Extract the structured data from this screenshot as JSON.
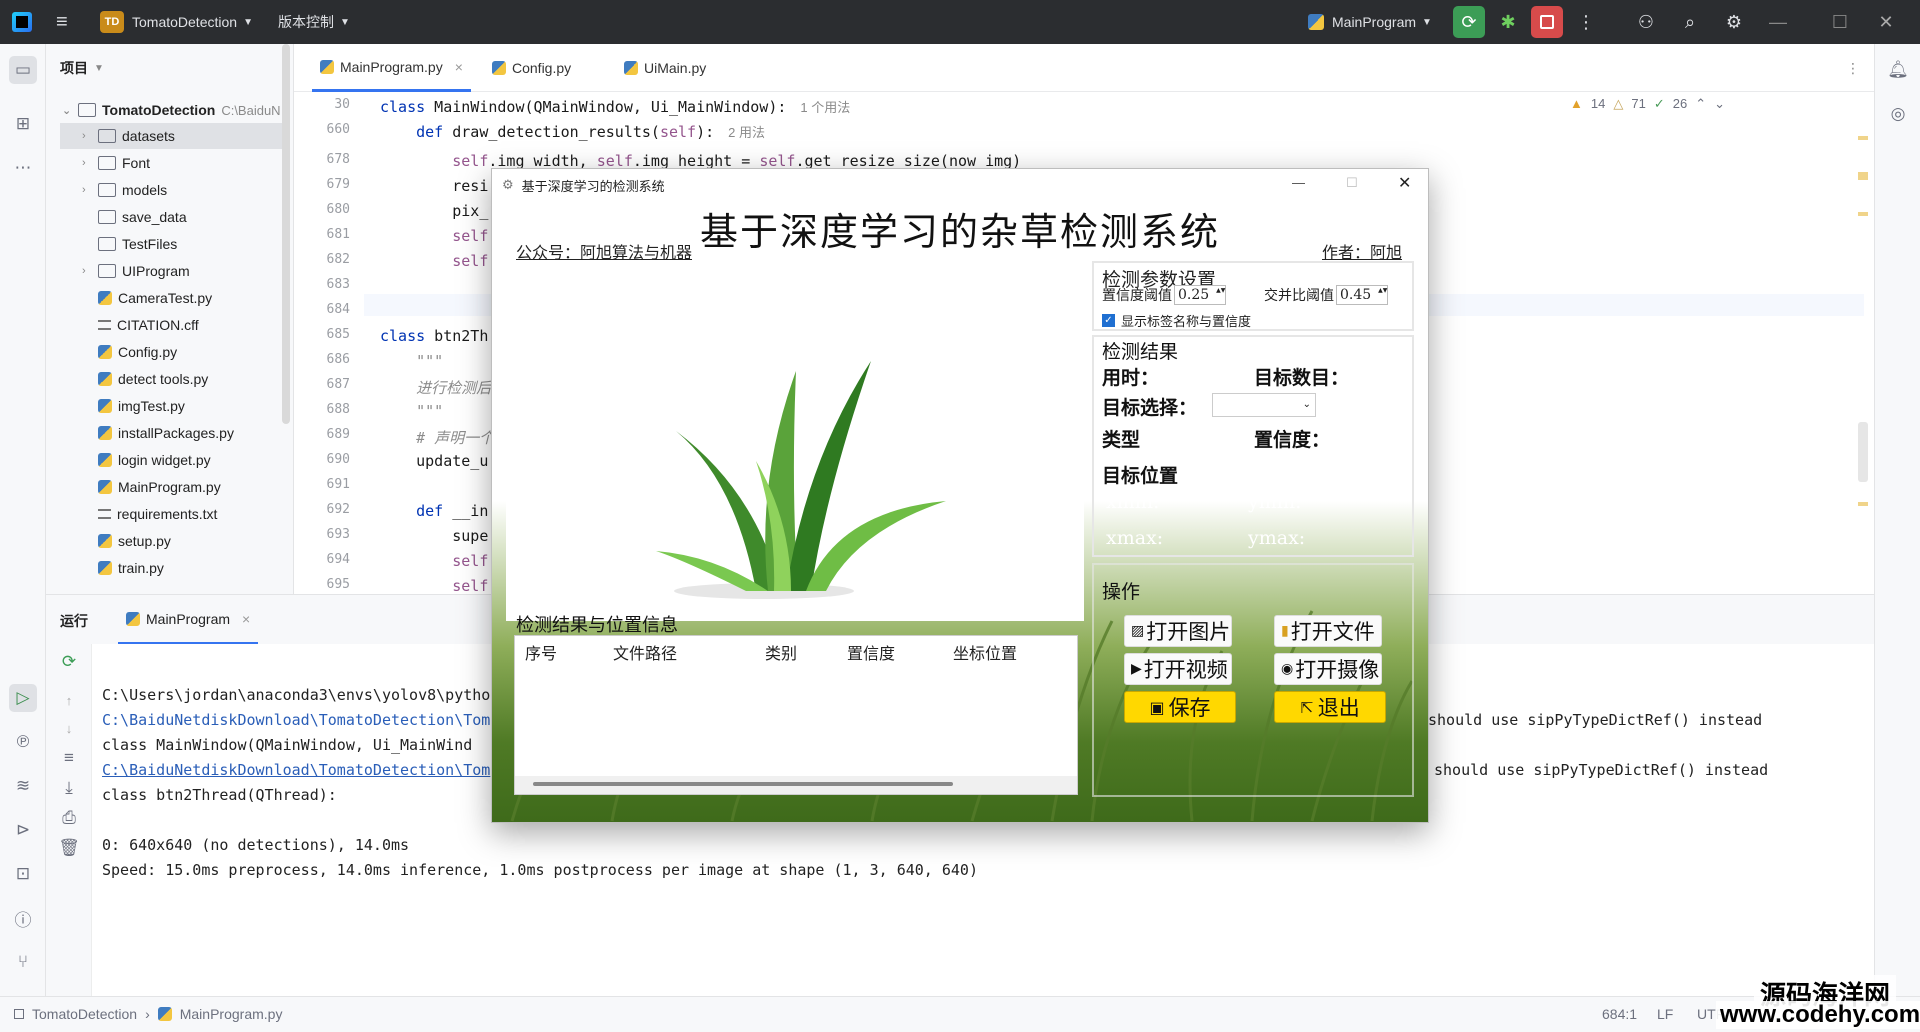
{
  "titlebar": {
    "project_badge": "TD",
    "project_name": "TomatoDetection",
    "vcs": "版本控制",
    "run_config": "MainProgram"
  },
  "project_panel": {
    "header": "项目",
    "root": "TomatoDetection",
    "root_path": "C:\\BaiduN",
    "items": [
      {
        "label": "datasets",
        "type": "folder",
        "expandable": true
      },
      {
        "label": "Font",
        "type": "folder",
        "expandable": true
      },
      {
        "label": "models",
        "type": "folder",
        "expandable": true
      },
      {
        "label": "save_data",
        "type": "folder",
        "expandable": false
      },
      {
        "label": "TestFiles",
        "type": "folder",
        "expandable": false
      },
      {
        "label": "UIProgram",
        "type": "folder",
        "expandable": true
      },
      {
        "label": "CameraTest.py",
        "type": "py"
      },
      {
        "label": "CITATION.cff",
        "type": "txt"
      },
      {
        "label": "Config.py",
        "type": "py"
      },
      {
        "label": "detect tools.py",
        "type": "py"
      },
      {
        "label": "imgTest.py",
        "type": "py"
      },
      {
        "label": "installPackages.py",
        "type": "py"
      },
      {
        "label": "login widget.py",
        "type": "py"
      },
      {
        "label": "MainProgram.py",
        "type": "py"
      },
      {
        "label": "requirements.txt",
        "type": "txt"
      },
      {
        "label": "setup.py",
        "type": "py"
      },
      {
        "label": "train.py",
        "type": "py"
      }
    ]
  },
  "editor": {
    "tabs": [
      "MainProgram.py",
      "Config.py",
      "UiMain.py"
    ],
    "inspections": {
      "warnings": "14",
      "weak": "71",
      "ok": "26"
    },
    "lines": [
      {
        "n": "30",
        "code": "class MainWindow(QMainWindow, Ui_MainWindow):",
        "hint": "1 个用法"
      },
      {
        "n": "660",
        "code": "    def draw_detection_results(self):",
        "hint": "2 用法"
      },
      {
        "n": "678",
        "code": "        self.img_width, self.img_height = self.get_resize_size(now_img)",
        "hint": ""
      },
      {
        "n": "679",
        "code": "        resi",
        "hint": ""
      },
      {
        "n": "680",
        "code": "        pix_",
        "hint": ""
      },
      {
        "n": "681",
        "code": "        self",
        "hint": ""
      },
      {
        "n": "682",
        "code": "        self",
        "hint": ""
      },
      {
        "n": "683",
        "code": "",
        "hint": ""
      },
      {
        "n": "684",
        "code": "",
        "hint": ""
      },
      {
        "n": "685",
        "code": "class btn2Th",
        "hint": ""
      },
      {
        "n": "686",
        "code": "    \"\"\"",
        "hint": ""
      },
      {
        "n": "687",
        "code": "    进行检测后",
        "hint": ""
      },
      {
        "n": "688",
        "code": "    \"\"\"",
        "hint": ""
      },
      {
        "n": "689",
        "code": "    # 声明一个",
        "hint": ""
      },
      {
        "n": "690",
        "code": "    update_u",
        "hint": ""
      },
      {
        "n": "691",
        "code": "",
        "hint": ""
      },
      {
        "n": "692",
        "code": "    def __in",
        "hint": ""
      },
      {
        "n": "693",
        "code": "        supe",
        "hint": ""
      },
      {
        "n": "694",
        "code": "        self",
        "hint": ""
      },
      {
        "n": "695",
        "code": "        self",
        "hint": ""
      }
    ]
  },
  "run_panel": {
    "tab_run": "运行",
    "tab_config": "MainProgram",
    "console": [
      "C:\\Users\\jordan\\anaconda3\\envs\\yolov8\\pytho",
      "C:\\BaiduNetdiskDownload\\TomatoDetection\\Tom",
      "  class MainWindow(QMainWindow, Ui_MainWind",
      "C:\\BaiduNetdiskDownload\\TomatoDetection\\Tom",
      "  class btn2Thread(QThread):",
      "",
      "0: 640x640 (no detections), 14.0ms",
      "Speed: 15.0ms preprocess, 14.0ms inference, 1.0ms postprocess per image at shape (1, 3, 640, 640)"
    ],
    "console_right_1": "should use sipPyTypeDictRef() instead",
    "console_right_2": "should use sipPyTypeDictRef() instead"
  },
  "statusbar": {
    "breadcrumb_project": "TomatoDetection",
    "breadcrumb_file": "MainProgram.py",
    "position": "684:1",
    "line_sep": "LF",
    "encoding": "UTF-8",
    "watermark_1": "源码海洋网",
    "watermark_2": "www.codehy.com"
  },
  "app": {
    "window_title": "基于深度学习的检测系统",
    "heading": "基于深度学习的杂草检测系统",
    "public_account": "公众号：阿旭算法与机器",
    "author": "作者：阿旭",
    "params": {
      "group_title": "检测参数设置",
      "conf_label": "置信度阈值",
      "conf_value": "0.25",
      "iou_label": "交并比阈值",
      "iou_value": "0.45",
      "show_labels": "显示标签名称与置信度",
      "show_labels_checked": true
    },
    "results": {
      "group_title": "检测结果",
      "time_label": "用时：",
      "count_label": "目标数目：",
      "select_label": "目标选择：",
      "type_label": "类型",
      "conf_label": "置信度：",
      "pos_label": "目标位置",
      "xmin": "xmin:",
      "ymin": "ymin:",
      "xmax": "xmax:",
      "ymax": "ymax:"
    },
    "table": {
      "title": "检测结果与位置信息",
      "columns": [
        "序号",
        "文件路径",
        "类别",
        "置信度",
        "坐标位置"
      ]
    },
    "ops": {
      "group_title": "操作",
      "open_image": "打开图片",
      "open_folder": "打开文件",
      "open_video": "打开视频",
      "open_camera": "打开摄像",
      "save": "保存",
      "exit": "退出"
    }
  }
}
